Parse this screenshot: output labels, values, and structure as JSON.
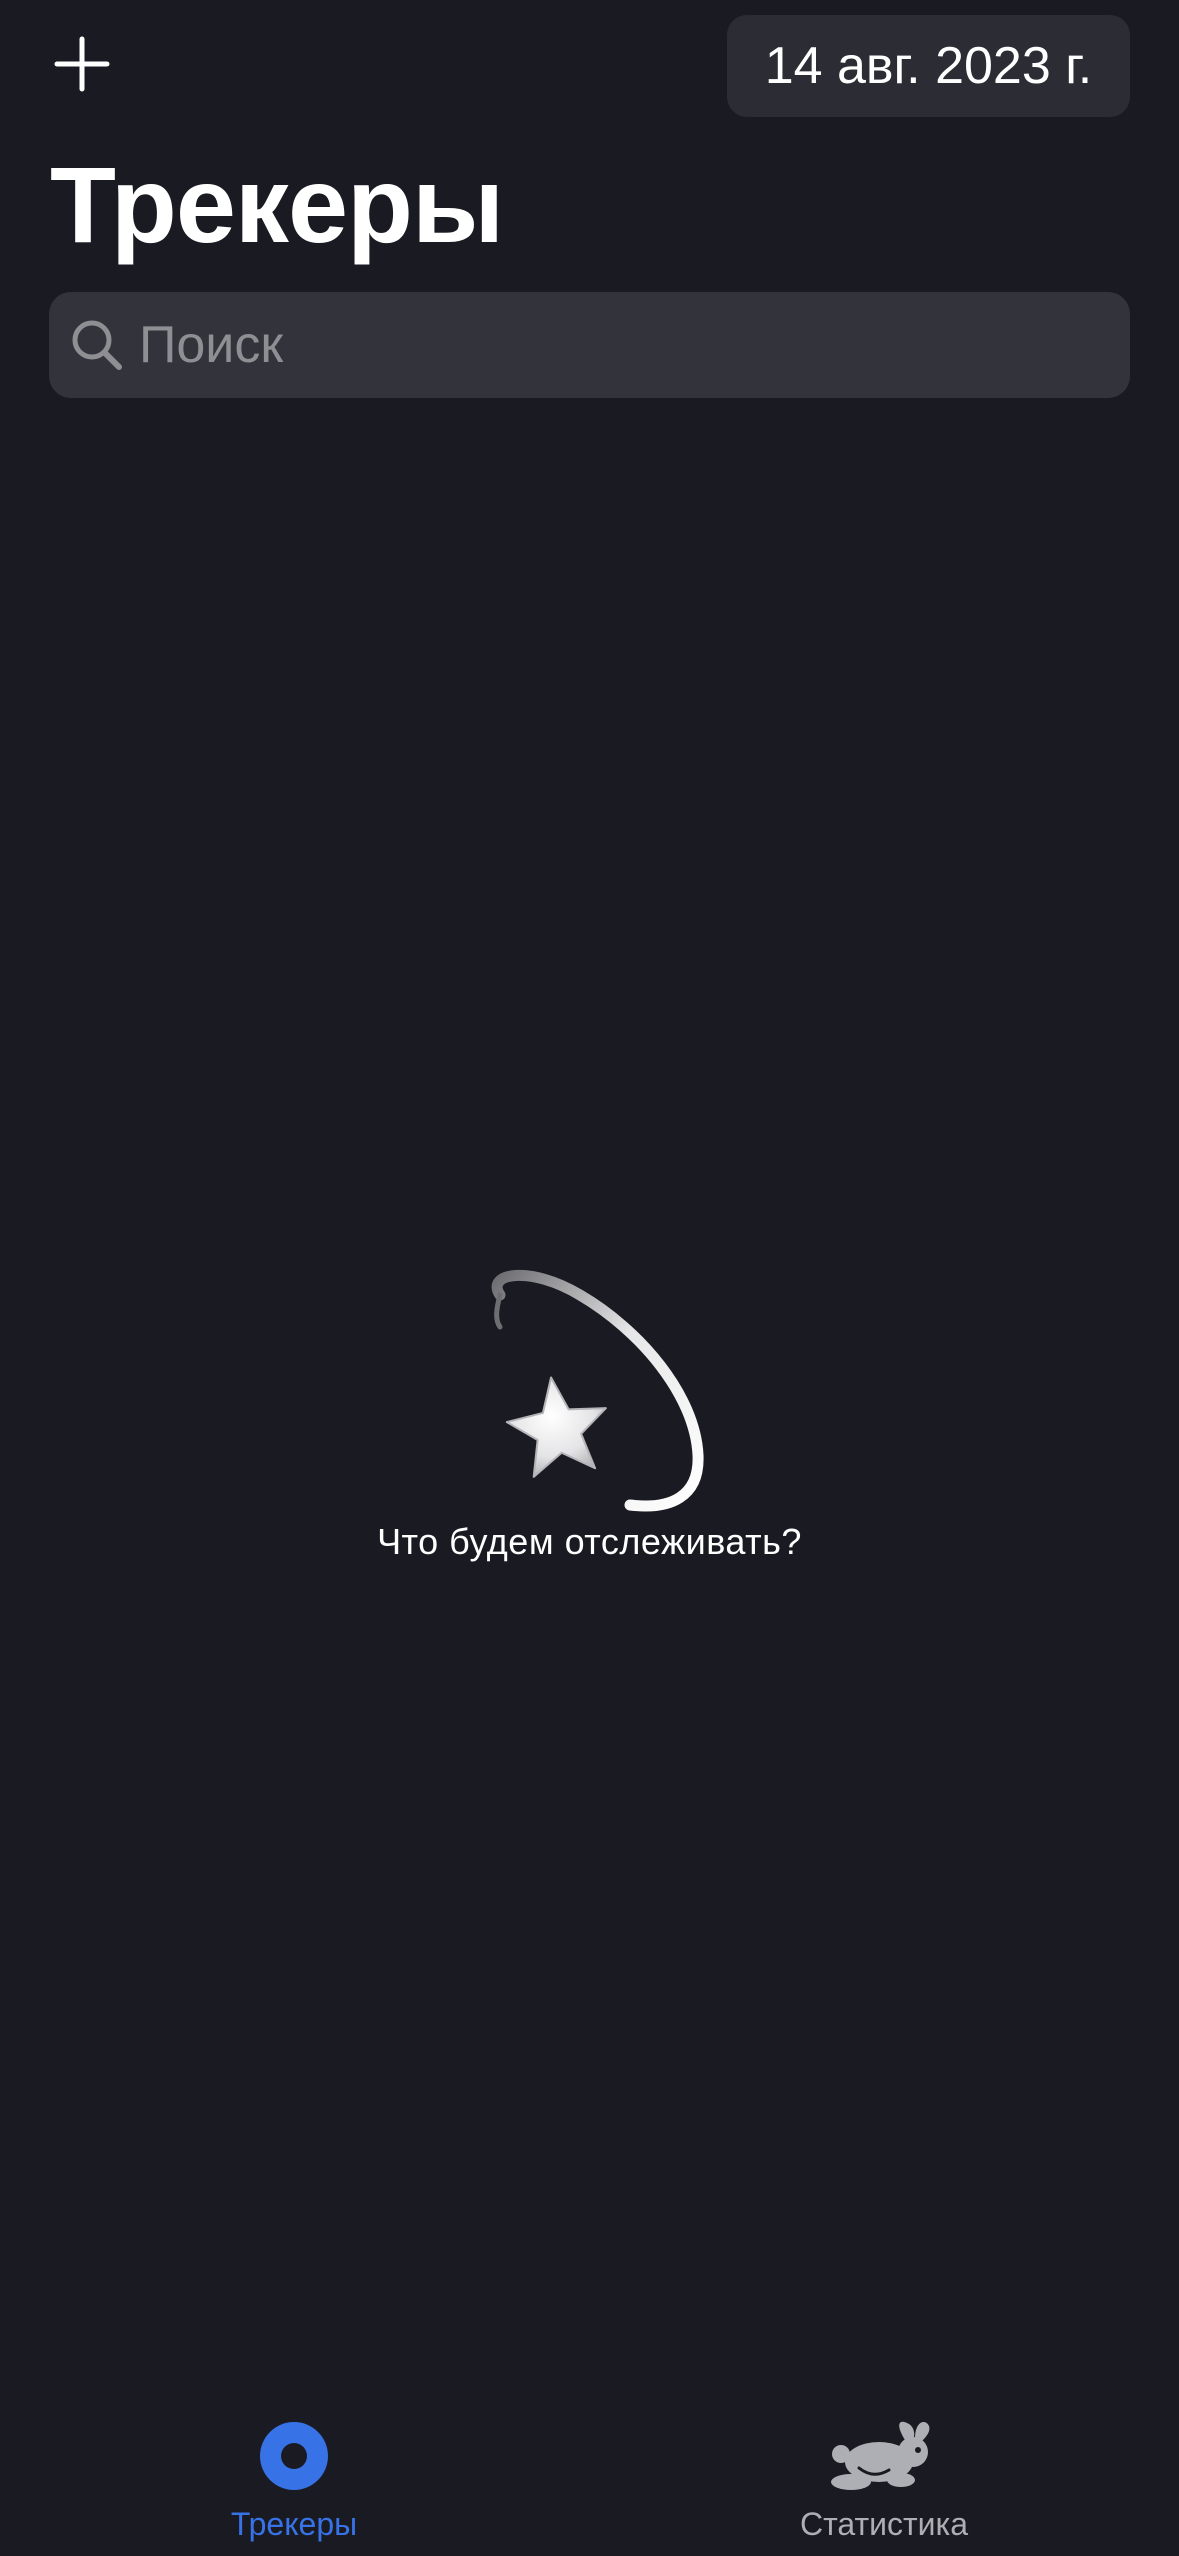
{
  "header": {
    "add_icon": "plus-icon",
    "date_label": "14 авг. 2023 г.",
    "title": "Трекеры"
  },
  "search": {
    "icon": "search-icon",
    "placeholder": "Поиск",
    "value": ""
  },
  "empty_state": {
    "icon": "shooting-star-icon",
    "text": "Что будем отслеживать?"
  },
  "tabbar": {
    "tabs": [
      {
        "label": "Трекеры",
        "icon": "trackers-record-icon",
        "selected": true
      },
      {
        "label": "Статистика",
        "icon": "rabbit-icon",
        "selected": false
      }
    ]
  },
  "colors": {
    "background": "#1A1B22",
    "accent": "#3772E7",
    "date_pill": "#2B2C34",
    "search_field": "#32333B",
    "placeholder": "#8E8E93",
    "inactive_tab": "#AEAFB4"
  }
}
